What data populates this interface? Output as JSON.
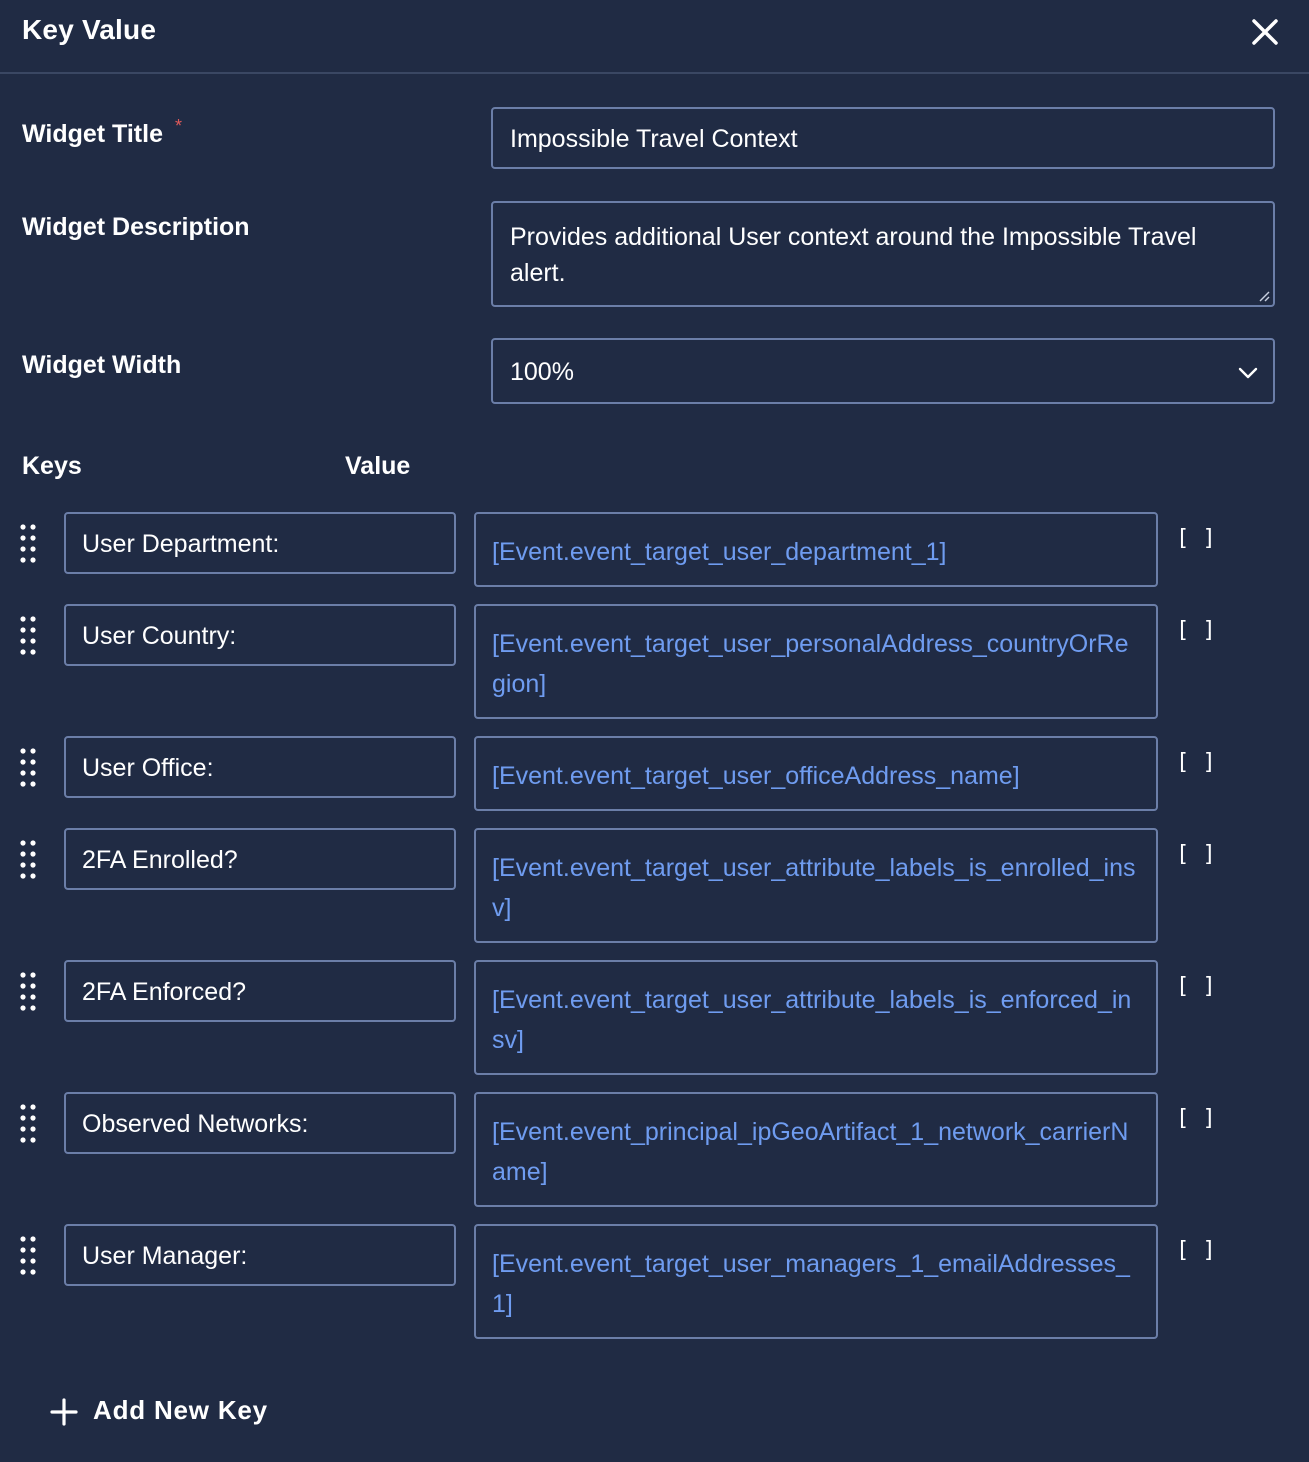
{
  "header": {
    "title": "Key Value"
  },
  "form": {
    "title_label": "Widget Title",
    "required_mark": "*",
    "title_value": "Impossible Travel Context",
    "description_label": "Widget Description",
    "description_value": "Provides additional User context around the Impossible Travel alert.",
    "width_label": "Widget Width",
    "width_value": "100%"
  },
  "columns": {
    "keys": "Keys",
    "value": "Value"
  },
  "rows": [
    {
      "key": "User Department:",
      "value": "[Event.event_target_user_department_1]"
    },
    {
      "key": "User Country:",
      "value": "[Event.event_target_user_personalAddress_countryOrRegion]"
    },
    {
      "key": "User Office:",
      "value": "[Event.event_target_user_officeAddress_name]"
    },
    {
      "key": "2FA Enrolled?",
      "value": "[Event.event_target_user_attribute_labels_is_enrolled_insv]"
    },
    {
      "key": "2FA Enforced?",
      "value": "[Event.event_target_user_attribute_labels_is_enforced_insv]"
    },
    {
      "key": "Observed Networks:",
      "value": "[Event.event_principal_ipGeoArtifact_1_network_carrierName]"
    },
    {
      "key": "User Manager:",
      "value": "[Event.event_target_user_managers_1_emailAddresses_1]"
    }
  ],
  "bracket_label": "[ ]",
  "add_key_label": "Add New Key",
  "colors": {
    "background": "#202b44",
    "border": "#6b7ea8",
    "value_text": "#6f9cf0",
    "required": "#e05a5a"
  }
}
